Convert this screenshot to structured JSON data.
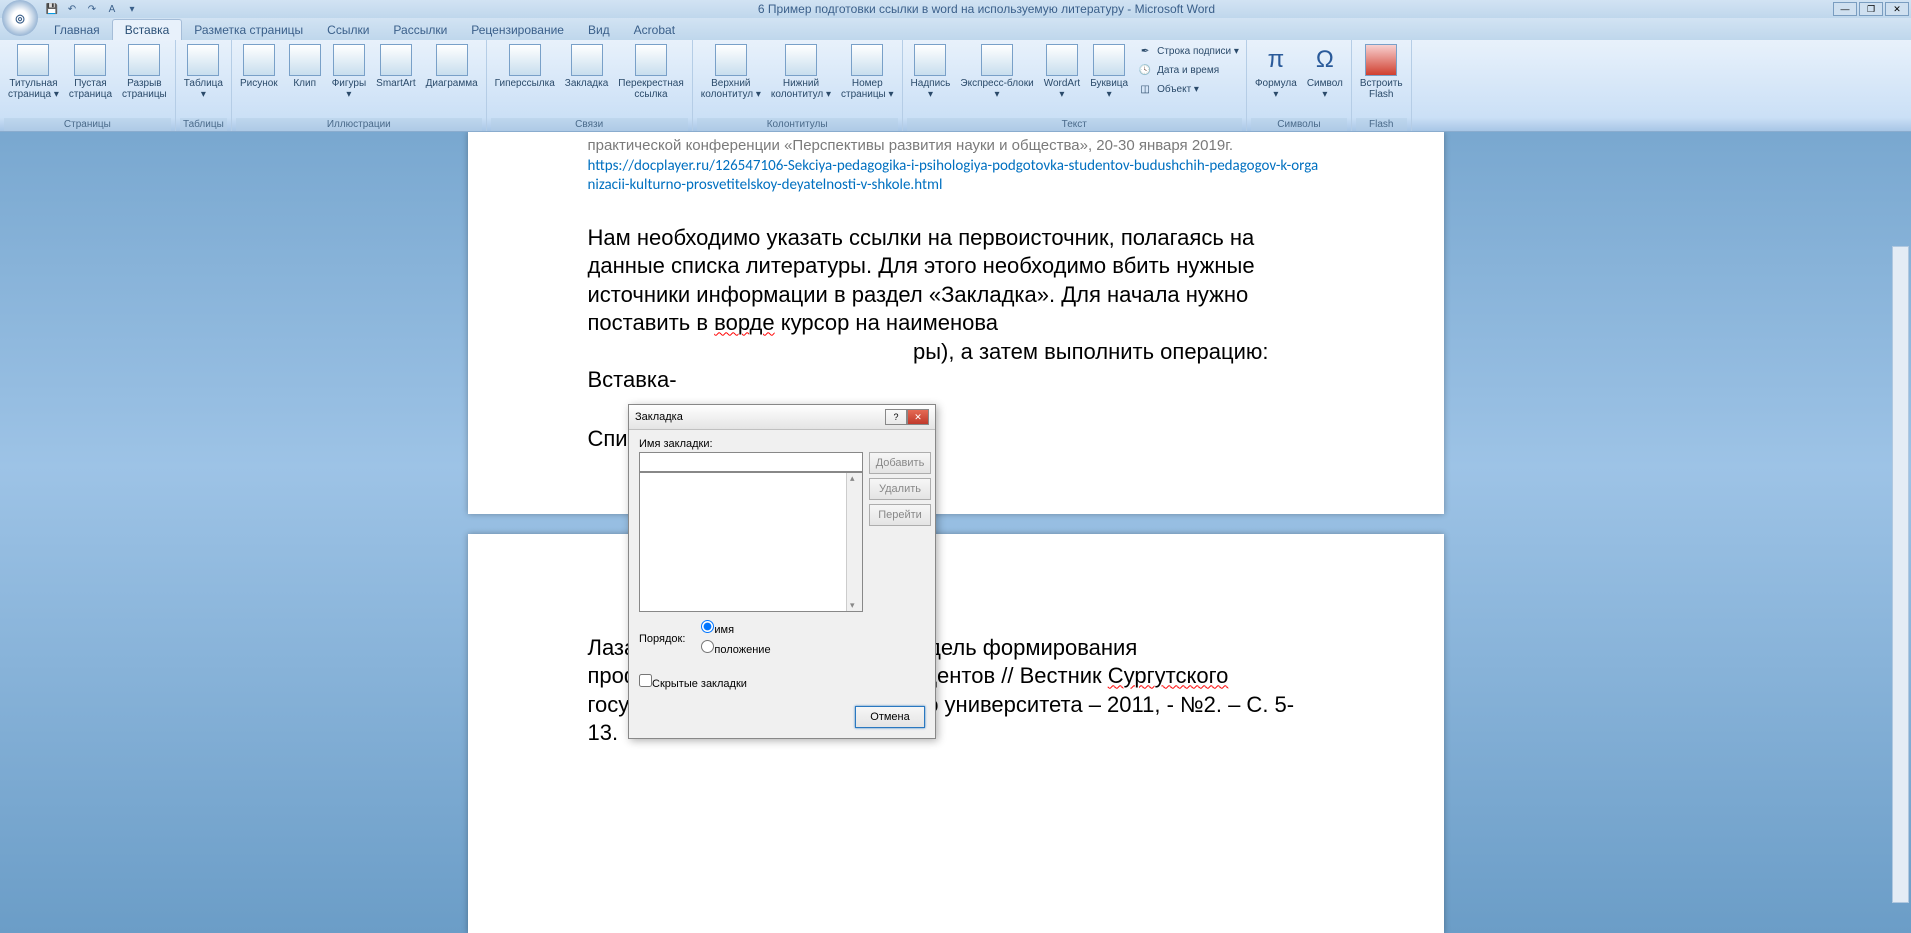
{
  "window": {
    "title": "6 Пример подготовки ссылки в word на используемую литературу - Microsoft Word"
  },
  "tabs": {
    "items": [
      "Главная",
      "Вставка",
      "Разметка страницы",
      "Ссылки",
      "Рассылки",
      "Рецензирование",
      "Вид",
      "Acrobat"
    ],
    "active_index": 1
  },
  "ribbon": {
    "groups": {
      "pages": {
        "label": "Страницы",
        "cover": "Титульная\nстраница ▾",
        "blank": "Пустая\nстраница",
        "break": "Разрыв\nстраницы"
      },
      "tables": {
        "label": "Таблицы",
        "table": "Таблица\n▾"
      },
      "illustrations": {
        "label": "Иллюстрации",
        "picture": "Рисунок",
        "clip": "Клип",
        "shapes": "Фигуры\n▾",
        "smartart": "SmartArt",
        "chart": "Диаграмма"
      },
      "links": {
        "label": "Связи",
        "hyperlink": "Гиперссылка",
        "bookmark": "Закладка",
        "crossref": "Перекрестная\nссылка"
      },
      "headerfooter": {
        "label": "Колонтитулы",
        "header": "Верхний\nколонтитул ▾",
        "footer": "Нижний\nколонтитул ▾",
        "pagenum": "Номер\nстраницы ▾"
      },
      "text": {
        "label": "Текст",
        "textbox": "Надпись\n▾",
        "quickparts": "Экспресс-блоки\n▾",
        "wordart": "WordArt\n▾",
        "dropcap": "Буквица\n▾",
        "sigline": "Строка подписи ▾",
        "datetime": "Дата и время",
        "object": "Объект ▾"
      },
      "symbols": {
        "label": "Символы",
        "equation": "Формула\n▾",
        "symbol": "Символ\n▾"
      },
      "flash": {
        "label": "Flash",
        "embed": "Встроить\nFlash"
      }
    }
  },
  "document": {
    "p1_line1": "практической конференции «Перспективы развития науки и общества», 20-30 января 2019г.",
    "p1_link": "https://docplayer.ru/126547106-Sekciya-pedagogika-i-psihologiya-podgotovka-studentov-budushchih-pedagogov-k-organizacii-kulturno-prosvetitelskoy-deyatelnosti-v-shkole.html",
    "p2_part1": "Нам необходимо указать ссылки на первоисточник, полагаясь на данные списка литературы. Для этого необходимо вбить нужные источники информации в раздел «Закладка». Для начала нужно поставить в ",
    "p2_sq1": "ворде",
    "p2_part2": " курсор на наименова",
    "p2_part3": "ры), а затем выполнить операцию: Вставка-",
    "heading": "Список литературы",
    "p3_part1": "Лазарев В.С. Концептуальная модель формирования профессиональных умений у студентов // Вестник ",
    "p3_sq1": "Сургутского",
    "p3_part2": " государственного педагогического университета – 2011, - №2. – С. 5-13."
  },
  "dialog": {
    "title": "Закладка",
    "name_label": "Имя закладки:",
    "add": "Добавить",
    "delete": "Удалить",
    "goto": "Перейти",
    "sort_label": "Порядок:",
    "sort_name": "имя",
    "sort_pos": "положение",
    "hidden": "Скрытые закладки",
    "cancel": "Отмена"
  }
}
